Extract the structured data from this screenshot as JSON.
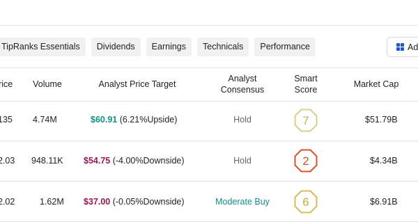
{
  "tabs": [
    "TipRanks Essentials",
    "Dividends",
    "Earnings",
    "Technicals",
    "Performance"
  ],
  "add_button": {
    "label": "Add",
    "icon": "grid-icon"
  },
  "headers": {
    "price": "Price",
    "volume": "Volume",
    "apt": "Analyst Price Target",
    "consensus_l1": "Analyst",
    "consensus_l2": "Consensus",
    "smart_l1": "Smart",
    "smart_l2": "Score",
    "mcap": "Market Cap"
  },
  "rows": [
    {
      "price": "135",
      "volume": "4.74M",
      "target_price": "$60.91",
      "target_change": "(6.21%Upside)",
      "direction": "up",
      "consensus": "Hold",
      "score": "7",
      "score_color": "#d8cf8a",
      "market_cap": "$51.79B"
    },
    {
      "price": "2.03",
      "volume": "948.11K",
      "target_price": "$54.75",
      "target_change": "(-4.00%Downside)",
      "direction": "down",
      "consensus": "Hold",
      "score": "2",
      "score_color": "#d9512a",
      "market_cap": "$4.34B"
    },
    {
      "price": "2.02",
      "volume": "1.62M",
      "target_price": "$37.00",
      "target_change": "(-0.05%Downside)",
      "direction": "down",
      "consensus": "Moderate Buy",
      "score": "6",
      "score_color": "#d4bd5e",
      "market_cap": "$6.91B"
    }
  ],
  "colors": {
    "upside": "#148f86",
    "downside": "#9a1853",
    "hold": "#666666",
    "moderate_buy": "#148f86",
    "add_icon": "#1e57d6"
  }
}
